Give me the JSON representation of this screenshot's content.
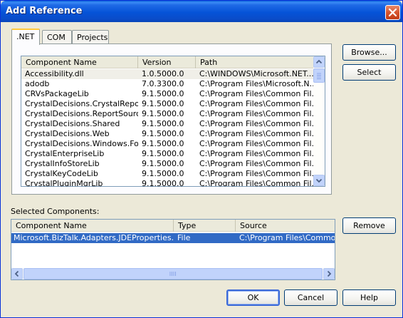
{
  "window": {
    "title": "Add Reference"
  },
  "tabs": [
    {
      "label": ".NET"
    },
    {
      "label": "COM"
    },
    {
      "label": "Projects"
    }
  ],
  "components_list": {
    "columns": [
      "Component Name",
      "Version",
      "Path"
    ],
    "rows": [
      {
        "name": "Accessibility.dll",
        "version": "1.0.5000.0",
        "path": "C:\\WINDOWS\\Microsoft.NET..."
      },
      {
        "name": "adodb",
        "version": "7.0.3300.0",
        "path": "C:\\Program Files\\Microsoft.N..."
      },
      {
        "name": "CRVsPackageLib",
        "version": "9.1.5000.0",
        "path": "C:\\Program Files\\Common Fil..."
      },
      {
        "name": "CrystalDecisions.CrystalRepo...",
        "version": "9.1.5000.0",
        "path": "C:\\Program Files\\Common Fil..."
      },
      {
        "name": "CrystalDecisions.ReportSource",
        "version": "9.1.5000.0",
        "path": "C:\\Program Files\\Common Fil..."
      },
      {
        "name": "CrystalDecisions.Shared",
        "version": "9.1.5000.0",
        "path": "C:\\Program Files\\Common Fil..."
      },
      {
        "name": "CrystalDecisions.Web",
        "version": "9.1.5000.0",
        "path": "C:\\Program Files\\Common Fil..."
      },
      {
        "name": "CrystalDecisions.Windows.Fo...",
        "version": "9.1.5000.0",
        "path": "C:\\Program Files\\Common Fil..."
      },
      {
        "name": "CrystalEnterpriseLib",
        "version": "9.1.5000.0",
        "path": "C:\\Program Files\\Common Fil..."
      },
      {
        "name": "CrystalInfoStoreLib",
        "version": "9.1.5000.0",
        "path": "C:\\Program Files\\Common Fil..."
      },
      {
        "name": "CrystalKeyCodeLib",
        "version": "9.1.5000.0",
        "path": "C:\\Program Files\\Common Fil..."
      },
      {
        "name": "CrystalPluginMgrLib",
        "version": "9.1.5000.0",
        "path": "C:\\Program Files\\Common Fil..."
      }
    ]
  },
  "buttons": {
    "browse": "Browse...",
    "select": "Select",
    "remove": "Remove",
    "ok": "OK",
    "cancel": "Cancel",
    "help": "Help"
  },
  "selected": {
    "label": "Selected Components:",
    "columns": [
      "Component Name",
      "Type",
      "Source"
    ],
    "rows": [
      {
        "name": "Microsoft.BizTalk.Adapters.JDEProperties.dll",
        "type": "File",
        "source": "C:\\Program Files\\Common Fi"
      }
    ]
  },
  "colors": {
    "title_bar": "#0553d8",
    "selection": "#316ac5",
    "tab_highlight": "#ffc83c"
  }
}
